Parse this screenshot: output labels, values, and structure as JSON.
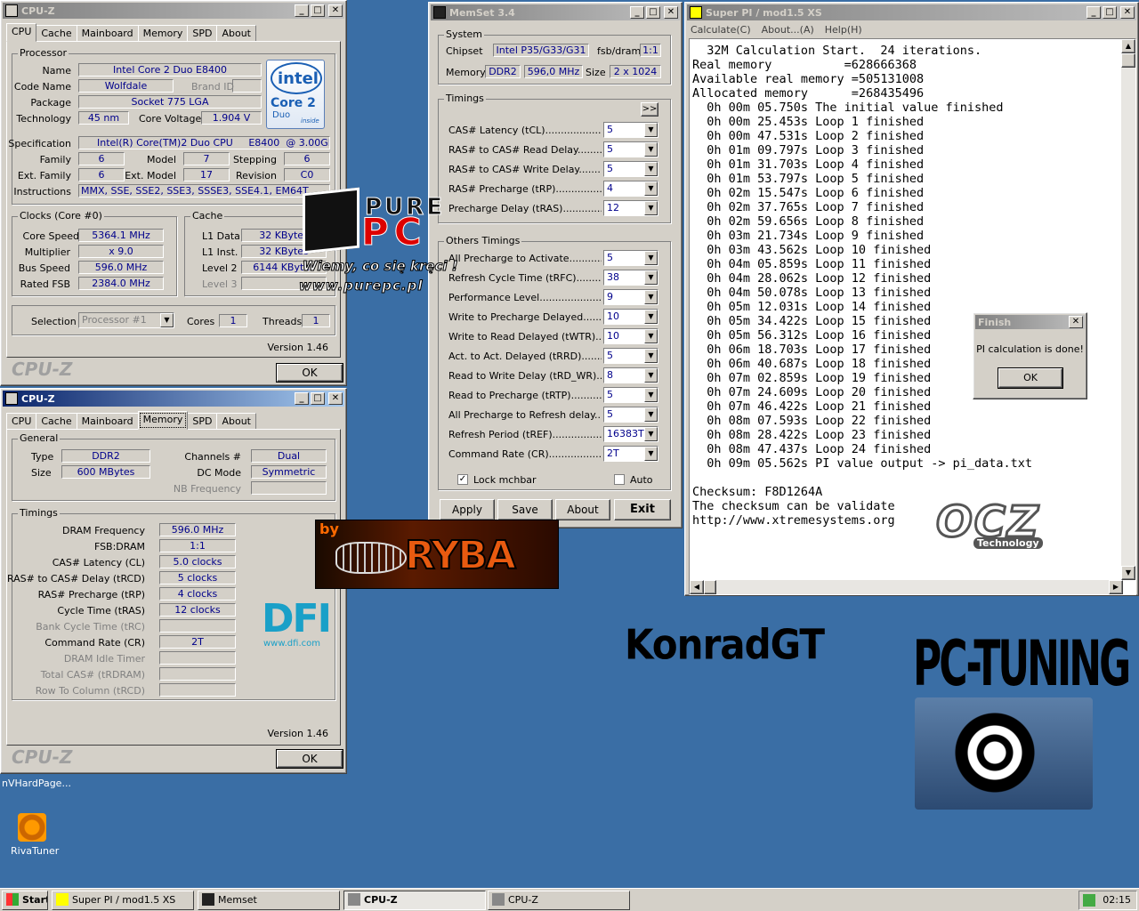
{
  "cpuz1": {
    "title": "CPU-Z",
    "tabs": [
      "CPU",
      "Cache",
      "Mainboard",
      "Memory",
      "SPD",
      "About"
    ],
    "processor_label": "Processor",
    "name_label": "Name",
    "name": "Intel Core 2 Duo E8400",
    "codename_label": "Code Name",
    "codename": "Wolfdale",
    "brandid_label": "Brand ID",
    "package_label": "Package",
    "package": "Socket 775 LGA",
    "tech_label": "Technology",
    "tech": "45 nm",
    "voltage_label": "Core Voltage",
    "voltage": "1.904 V",
    "spec_label": "Specification",
    "spec": "Intel(R) Core(TM)2 Duo CPU     E8400  @ 3.00GHz",
    "family_label": "Family",
    "family": "6",
    "model_label": "Model",
    "model": "7",
    "stepping_label": "Stepping",
    "stepping": "6",
    "extfamily_label": "Ext. Family",
    "extfamily": "6",
    "extmodel_label": "Ext. Model",
    "extmodel": "17",
    "revision_label": "Revision",
    "revision": "C0",
    "instr_label": "Instructions",
    "instr": "MMX, SSE, SSE2, SSE3, SSSE3, SSE4.1, EM64T",
    "clocks_label": "Clocks (Core #0)",
    "corespeed_label": "Core Speed",
    "corespeed": "5364.1 MHz",
    "mult_label": "Multiplier",
    "mult": "x 9.0",
    "bus_label": "Bus Speed",
    "bus": "596.0 MHz",
    "fsb_label": "Rated FSB",
    "fsb": "2384.0 MHz",
    "cache_label": "Cache",
    "l1d_label": "L1 Data",
    "l1d": "32 KBytes",
    "l1i_label": "L1 Inst.",
    "l1i": "32 KBytes",
    "l2_label": "Level 2",
    "l2": "6144 KBytes",
    "l3_label": "Level 3",
    "selection_label": "Selection",
    "selection": "Processor #1",
    "cores_label": "Cores",
    "cores": "1",
    "threads_label": "Threads",
    "threads": "1",
    "version": "Version 1.46",
    "brand": "CPU-Z",
    "ok": "OK",
    "intel": {
      "word": "intel",
      "line1": "Core 2",
      "line2": "Duo",
      "inside": "inside"
    }
  },
  "cpuz2": {
    "title": "CPU-Z",
    "tabs": [
      "CPU",
      "Cache",
      "Mainboard",
      "Memory",
      "SPD",
      "About"
    ],
    "general_label": "General",
    "type_label": "Type",
    "type": "DDR2",
    "size_label": "Size",
    "size": "600 MBytes",
    "channels_label": "Channels #",
    "channels": "Dual",
    "dcmode_label": "DC Mode",
    "dcmode": "Symmetric",
    "nbfreq_label": "NB Frequency",
    "timings_label": "Timings",
    "timings": [
      {
        "label": "DRAM Frequency",
        "value": "596.0 MHz",
        "dis": false
      },
      {
        "label": "FSB:DRAM",
        "value": "1:1",
        "dis": false
      },
      {
        "label": "CAS# Latency (CL)",
        "value": "5.0 clocks",
        "dis": false
      },
      {
        "label": "RAS# to CAS# Delay (tRCD)",
        "value": "5 clocks",
        "dis": false
      },
      {
        "label": "RAS# Precharge (tRP)",
        "value": "4 clocks",
        "dis": false
      },
      {
        "label": "Cycle Time (tRAS)",
        "value": "12 clocks",
        "dis": false
      },
      {
        "label": "Bank Cycle Time (tRC)",
        "value": "",
        "dis": true
      },
      {
        "label": "Command Rate (CR)",
        "value": "2T",
        "dis": false
      },
      {
        "label": "DRAM Idle Timer",
        "value": "",
        "dis": true
      },
      {
        "label": "Total CAS# (tRDRAM)",
        "value": "",
        "dis": true
      },
      {
        "label": "Row To Column (tRCD)",
        "value": "",
        "dis": true
      }
    ],
    "version": "Version 1.46",
    "brand": "CPU-Z",
    "ok": "OK"
  },
  "memset": {
    "title": "MemSet 3.4",
    "system_label": "System",
    "chipset_label": "Chipset",
    "chipset": "Intel P35/G33/G31",
    "fsbdram_label": "fsb/dram",
    "fsbdram": "1:1",
    "memory_label": "Memory",
    "memory": "DDR2",
    "freq": "596,0 MHz",
    "size_label": "Size",
    "size": "2 x 1024",
    "timings_label": "Timings",
    "expand": ">>",
    "timings": [
      {
        "label": "CAS# Latency (tCL)",
        "value": "5"
      },
      {
        "label": "RAS# to CAS# Read Delay",
        "value": "5"
      },
      {
        "label": "RAS# to CAS# Write Delay",
        "value": "5"
      },
      {
        "label": "RAS# Precharge (tRP)",
        "value": "4"
      },
      {
        "label": "Precharge Delay  (tRAS)",
        "value": "12"
      }
    ],
    "others_label": "Others Timings",
    "others": [
      {
        "label": "All Precharge to Activate",
        "value": "5"
      },
      {
        "label": "Refresh Cycle Time (tRFC)",
        "value": "38"
      },
      {
        "label": "Performance Level",
        "value": "9"
      },
      {
        "label": "Write to Precharge Delayed",
        "value": "10"
      },
      {
        "label": "Write to Read Delayed (tWTR)",
        "value": "10"
      },
      {
        "label": "Act. to Act. Delayed (tRRD)",
        "value": "5"
      },
      {
        "label": "Read to Write Delay (tRD_WR)",
        "value": "8"
      },
      {
        "label": "Read to Precharge (tRTP)",
        "value": "5"
      },
      {
        "label": "All Precharge to Refresh delay",
        "value": "5"
      },
      {
        "label": "Refresh Period (tREF)",
        "value": "16383T"
      },
      {
        "label": "Command Rate (CR)",
        "value": "2T"
      }
    ],
    "lock_label": "Lock mchbar",
    "auto_label": "Auto",
    "apply": "Apply",
    "save": "Save",
    "about": "About",
    "exit": "Exit"
  },
  "superpi": {
    "title": "Super PI / mod1.5 XS",
    "menu": [
      "Calculate(C)",
      "About...(A)",
      "Help(H)"
    ],
    "lines": [
      "  32M Calculation Start.  24 iterations.",
      "Real memory          =628666368",
      "Available real memory =505131008",
      "Allocated memory      =268435496",
      "  0h 00m 05.750s The initial value finished",
      "  0h 00m 25.453s Loop 1 finished",
      "  0h 00m 47.531s Loop 2 finished",
      "  0h 01m 09.797s Loop 3 finished",
      "  0h 01m 31.703s Loop 4 finished",
      "  0h 01m 53.797s Loop 5 finished",
      "  0h 02m 15.547s Loop 6 finished",
      "  0h 02m 37.765s Loop 7 finished",
      "  0h 02m 59.656s Loop 8 finished",
      "  0h 03m 21.734s Loop 9 finished",
      "  0h 03m 43.562s Loop 10 finished",
      "  0h 04m 05.859s Loop 11 finished",
      "  0h 04m 28.062s Loop 12 finished",
      "  0h 04m 50.078s Loop 13 finished",
      "  0h 05m 12.031s Loop 14 finished",
      "  0h 05m 34.422s Loop 15 finished",
      "  0h 05m 56.312s Loop 16 finished",
      "  0h 06m 18.703s Loop 17 finished",
      "  0h 06m 40.687s Loop 18 finished",
      "  0h 07m 02.859s Loop 19 finished",
      "  0h 07m 24.609s Loop 20 finished",
      "  0h 07m 46.422s Loop 21 finished",
      "  0h 08m 07.593s Loop 22 finished",
      "  0h 08m 28.422s Loop 23 finished",
      "  0h 08m 47.437s Loop 24 finished",
      "  0h 09m 05.562s PI value output -> pi_data.txt",
      "",
      "Checksum: F8D1264A",
      "The checksum can be validate",
      "http://www.xtremesystems.org"
    ]
  },
  "finish": {
    "title": "Finish",
    "message": "PI calculation is done!",
    "ok": "OK"
  },
  "overlay": {
    "purepc_top": "PURE",
    "purepc_bottom": "PC",
    "slogan": "Wiemy, co się kręci !",
    "url": "www.purepc.pl",
    "by": "by",
    "ryba": "RYBA",
    "dfi": "DFI",
    "dfi_url": "www.dfi.com",
    "ocz": "OCZ",
    "ocz_tech": "Technology",
    "konrad": "KonradGT",
    "pctuning": "PC-TUNING"
  },
  "desktop": {
    "nvhard": "nVHardPage...",
    "rivatuner": "RivaTuner"
  },
  "taskbar": {
    "start": "Start",
    "items": [
      {
        "label": "Super PI / mod1.5 XS",
        "pressed": false
      },
      {
        "label": "Memset",
        "pressed": false
      },
      {
        "label": "CPU-Z",
        "pressed": true
      },
      {
        "label": "CPU-Z",
        "pressed": false
      }
    ],
    "clock": "02:15"
  }
}
